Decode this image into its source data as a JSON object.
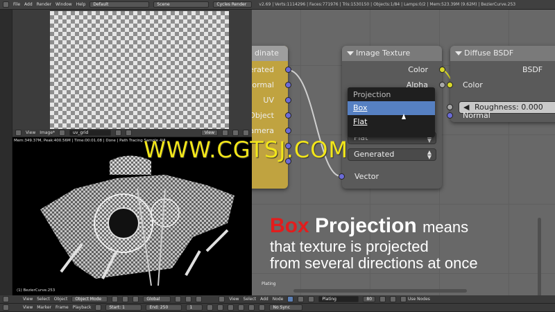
{
  "top_header": {
    "menus": [
      "File",
      "Add",
      "Render",
      "Window",
      "Help"
    ],
    "layout": "Default",
    "scene": "Scene",
    "engine": "Cycles Render",
    "info": "v2.69 | Verts:1114296 | Faces:771976 | Tris:1530150 | Objects:1/84 | Lamps:0/2 | Mem:523.39M (9.62M) | BezierCurve.253"
  },
  "uv_header": {
    "menus": [
      "View",
      "Image*"
    ],
    "image_name": "uv_grid",
    "view": "View"
  },
  "viewport": {
    "render_stats": "Mem:349.37M, Peak:400.56M | Time:00:01.08 | Done | Path Tracing Sample 4/4",
    "object_label": "(1) BezierCurve.253"
  },
  "coord_node": {
    "title": "dinate",
    "outputs": [
      "erated",
      "ormal",
      "UV",
      "Object",
      "amera",
      "",
      ""
    ]
  },
  "image_texture_node": {
    "title": "Image Texture",
    "outputs": [
      "Color",
      "Alpha"
    ],
    "fields": [
      "Flat",
      "Generated"
    ],
    "input": "Vector"
  },
  "bsdf_node": {
    "title": "Diffuse BSDF",
    "output": "BSDF",
    "inputs": [
      "Color",
      "Normal"
    ],
    "roughness": "Roughness: 0.000"
  },
  "projection_menu": {
    "title": "Projection",
    "items": [
      "Box",
      "Flat"
    ],
    "selected": "Box"
  },
  "watermark": "WWW.CGTSJ.COM",
  "caption": {
    "red": "Box",
    "bold": "Projection",
    "means": "means",
    "line2": "that texture is projected",
    "line3": "from several directions at once"
  },
  "plating_label": "Plating",
  "bottom_bar_1": {
    "menus": [
      "View",
      "Select",
      "Object"
    ],
    "mode": "Object Mode",
    "orientation": "Global",
    "ne_menus": [
      "View",
      "Select",
      "Add",
      "Node"
    ],
    "material": "Plating",
    "users": "80",
    "use_nodes": "Use Nodes"
  },
  "bottom_bar_2": {
    "menus": [
      "View",
      "Marker",
      "Frame",
      "Playback"
    ],
    "start": "Start: 1",
    "end": "End: 250",
    "frame": "1",
    "sync": "No Sync"
  },
  "colors": {
    "accent_blue": "#5680c2",
    "socket_purple": "#6b6bd6",
    "socket_yellow": "#d8d82a",
    "watermark_yellow": "#f2e61a",
    "caption_red": "#e21d1d"
  }
}
